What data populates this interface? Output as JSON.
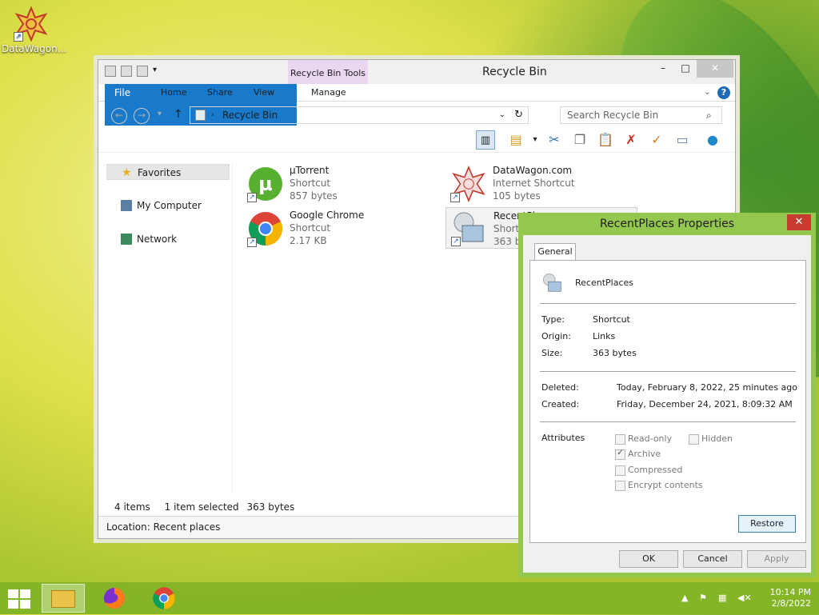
{
  "desktop": {
    "icon_label": "DataWagon..."
  },
  "explorer": {
    "title": "Recycle Bin",
    "context_tab": "Recycle Bin Tools",
    "tabs": [
      "File",
      "Home",
      "Share",
      "View",
      "Manage"
    ],
    "address": "Recycle Bin",
    "search_placeholder": "Search Recycle Bin",
    "nav": [
      "Favorites",
      "My Computer",
      "Network"
    ],
    "files": [
      {
        "name": "µTorrent",
        "type": "Shortcut",
        "size": "857 bytes"
      },
      {
        "name": "DataWagon.com",
        "type": "Internet Shortcut",
        "size": "105 bytes"
      },
      {
        "name": "Google Chrome",
        "type": "Shortcut",
        "size": "2.17 KB"
      },
      {
        "name": "RecentPlaces",
        "type": "Shortcut",
        "size": "363 bytes"
      }
    ],
    "status": {
      "items": "4 items",
      "selected": "1 item selected",
      "sel_size": "363 bytes"
    },
    "location": "Location: Recent places"
  },
  "dialog": {
    "title": "RecentPlaces Properties",
    "tab": "General",
    "name": "RecentPlaces",
    "type_label": "Type:",
    "type_value": "Shortcut",
    "origin_label": "Origin:",
    "origin_value": "Links",
    "size_label": "Size:",
    "size_value": "363 bytes",
    "deleted_label": "Deleted:",
    "deleted_value": "Today, February 8, 2022, 25 minutes ago",
    "created_label": "Created:",
    "created_value": "Friday, December 24, 2021, 8:09:32 AM",
    "attributes_label": "Attributes",
    "attr": {
      "readonly": "Read-only",
      "hidden": "Hidden",
      "archive": "Archive",
      "compressed": "Compressed",
      "encrypt": "Encrypt contents"
    },
    "restore": "Restore",
    "ok": "OK",
    "cancel": "Cancel",
    "apply": "Apply"
  },
  "taskbar": {
    "time": "10:14 PM",
    "date": "2/8/2022"
  },
  "colors": {
    "accent": "#1979ca",
    "dialog_frame": "#94c74e",
    "taskbar": "#78af23"
  }
}
